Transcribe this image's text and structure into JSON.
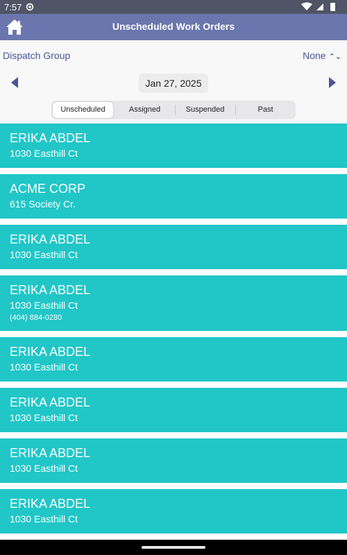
{
  "status_bar": {
    "time": "7:57"
  },
  "app_bar": {
    "title": "Unscheduled Work Orders"
  },
  "filter": {
    "dispatch_group_label": "Dispatch Group",
    "dispatch_group_value": "None",
    "date": "Jan 27, 2025"
  },
  "tabs": [
    {
      "label": "Unscheduled",
      "active": true
    },
    {
      "label": "Assigned",
      "active": false
    },
    {
      "label": "Suspended",
      "active": false
    },
    {
      "label": "Past",
      "active": false
    }
  ],
  "work_orders": [
    {
      "name": "ERIKA ABDEL",
      "address": "1030 Easthill Ct"
    },
    {
      "name": "ACME CORP",
      "address": "615 Society Cr."
    },
    {
      "name": "ERIKA ABDEL",
      "address": "1030 Easthill Ct"
    },
    {
      "name": "ERIKA ABDEL",
      "address": "1030 Easthill Ct",
      "phone": "(404) 884-0280"
    },
    {
      "name": "ERIKA ABDEL",
      "address": "1030 Easthill Ct"
    },
    {
      "name": "ERIKA ABDEL",
      "address": "1030 Easthill Ct"
    },
    {
      "name": "ERIKA ABDEL",
      "address": "1030 Easthill Ct"
    },
    {
      "name": "ERIKA ABDEL",
      "address": "1030 Easthill Ct"
    }
  ],
  "colors": {
    "app_bar": "#6a76ad",
    "card": "#21c6c7",
    "accent_text": "#4a5597"
  }
}
